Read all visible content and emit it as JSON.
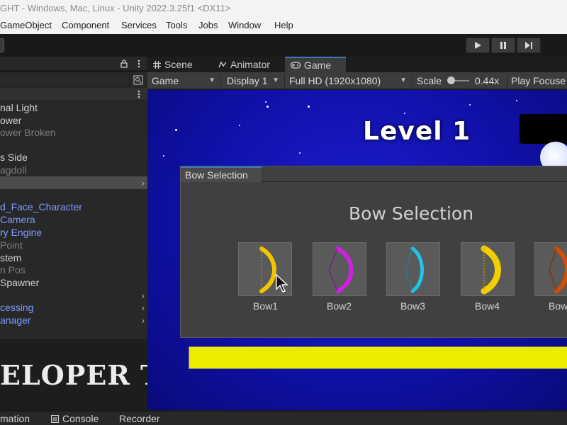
{
  "window": {
    "title": "GHT - Windows, Mac, Linux - Unity 2022.3.25f1 <DX11>"
  },
  "menu": [
    "GameObject",
    "Component",
    "Services",
    "Tools",
    "Jobs",
    "Window",
    "Help"
  ],
  "hierarchy": {
    "items": [
      {
        "label": "nal Light",
        "inactive": false
      },
      {
        "label": "ower",
        "inactive": false
      },
      {
        "label": "ower Broken",
        "inactive": true
      },
      {
        "label": "s Side",
        "inactive": false
      },
      {
        "label": "agdoll",
        "inactive": true
      },
      {
        "label": "",
        "inactive": false,
        "selected": true
      },
      {
        "label": "d_Face_Character",
        "inactive": false,
        "prefab": true
      },
      {
        "label": "Camera",
        "inactive": false,
        "prefab": true
      },
      {
        "label": "ry Engine",
        "inactive": false,
        "prefab": true
      },
      {
        "label": "Point",
        "inactive": true
      },
      {
        "label": "stem",
        "inactive": false
      },
      {
        "label": "n Pos",
        "inactive": true
      },
      {
        "label": "Spawner",
        "inactive": false
      },
      {
        "label": "",
        "inactive": false
      },
      {
        "label": "cessing",
        "inactive": false,
        "prefab": true
      },
      {
        "label": "anager",
        "inactive": false,
        "prefab": true
      }
    ]
  },
  "overlay": {
    "banner_text": "ELOPER TOOLS"
  },
  "tabs": [
    {
      "label": "Scene",
      "icon": "grid-icon"
    },
    {
      "label": "Animator",
      "icon": "animator-icon"
    },
    {
      "label": "Game",
      "icon": "gamepad-icon",
      "active": true
    }
  ],
  "gamebar": {
    "view_mode": "Game",
    "display": "Display 1",
    "resolution": "Full HD (1920x1080)",
    "scale_label": "Scale",
    "scale_value": "0.44x",
    "play_focused": "Play Focuse"
  },
  "game": {
    "level_title": "Level 1",
    "bow_panel_tab": "Bow Selection",
    "bow_heading": "Bow Selection",
    "bows": [
      {
        "label": "Bow1",
        "color": "#f5c400"
      },
      {
        "label": "Bow2",
        "color": "#cc22dd"
      },
      {
        "label": "Bow3",
        "color": "#22c4e8"
      },
      {
        "label": "Bow4",
        "color": "#f2d000"
      },
      {
        "label": "Bow",
        "color": "#d45000"
      }
    ]
  },
  "bottom_tabs": [
    "mation",
    "Console",
    "Recorder"
  ],
  "colors": {
    "accent": "#3a79bb",
    "prefab_text": "#7b9cff",
    "sky": "#1414b8",
    "yellow_bar": "#ecec00"
  }
}
